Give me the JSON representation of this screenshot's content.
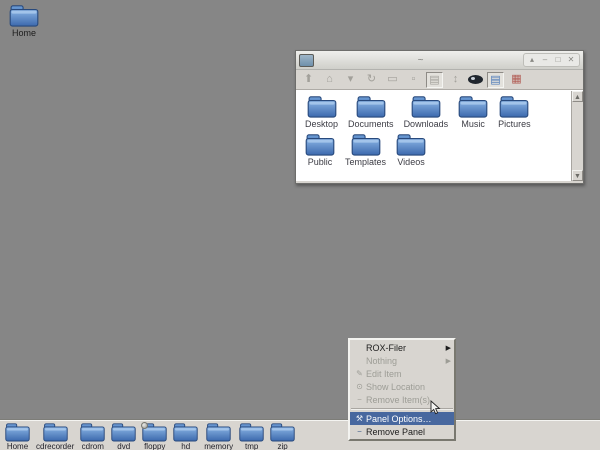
{
  "desktop": {
    "home_icon_label": "Home"
  },
  "window": {
    "title": "~",
    "titlebar_buttons": [
      {
        "name": "shade-button",
        "glyph": "▴"
      },
      {
        "name": "minimize-button",
        "glyph": "–"
      },
      {
        "name": "maximize-button",
        "glyph": "□"
      },
      {
        "name": "close-button",
        "glyph": "✕"
      }
    ],
    "toolbar_buttons": [
      {
        "name": "up-icon",
        "glyph": "⬆",
        "style": ""
      },
      {
        "name": "home-icon",
        "glyph": "⌂",
        "style": ""
      },
      {
        "name": "bookmarks-icon",
        "glyph": "▾",
        "style": ""
      },
      {
        "name": "refresh-icon",
        "glyph": "↻",
        "style": ""
      },
      {
        "name": "smaller-icons-icon",
        "glyph": "▭",
        "style": ""
      },
      {
        "name": "larger-icons-icon",
        "glyph": "▫",
        "style": ""
      },
      {
        "name": "icons-view-icon",
        "glyph": "▤",
        "style": "pressed"
      },
      {
        "name": "sort-icon",
        "glyph": "↕",
        "style": ""
      },
      {
        "name": "show-hidden-icon",
        "glyph": "",
        "style": "eye"
      },
      {
        "name": "details-view-icon",
        "glyph": "▤",
        "style": "pressed blue"
      },
      {
        "name": "select-all-icon",
        "glyph": "▦",
        "style": "red"
      }
    ],
    "folders": [
      "Desktop",
      "Documents",
      "Downloads",
      "Music",
      "Pictures",
      "Public",
      "Templates",
      "Videos"
    ],
    "scrollbar": {
      "up_glyph": "▲",
      "down_glyph": "▼"
    }
  },
  "menu": {
    "items": [
      {
        "label": "ROX-Filer",
        "state": "enabled",
        "icon": "",
        "submenu": true
      },
      {
        "label": "Nothing",
        "state": "disabled",
        "icon": "",
        "submenu": true
      },
      {
        "label": "Edit Item",
        "state": "disabled",
        "icon": "✎",
        "submenu": false
      },
      {
        "label": "Show Location",
        "state": "disabled",
        "icon": "⊙",
        "submenu": false
      },
      {
        "label": "Remove Item(s)",
        "state": "disabled",
        "icon": "−",
        "submenu": false
      },
      {
        "label": "Panel Options…",
        "state": "highlight",
        "icon": "⚒",
        "submenu": false
      },
      {
        "label": "Remove Panel",
        "state": "enabled",
        "icon": "−",
        "submenu": false
      }
    ],
    "separator_after_index": 4,
    "submenu_arrow": "▶"
  },
  "panel": {
    "items": [
      {
        "label": "Home",
        "emblem": false
      },
      {
        "label": "cdrecorder",
        "emblem": false
      },
      {
        "label": "cdrom",
        "emblem": false
      },
      {
        "label": "dvd",
        "emblem": false
      },
      {
        "label": "floppy",
        "emblem": true
      },
      {
        "label": "hd",
        "emblem": false
      },
      {
        "label": "memory",
        "emblem": false
      },
      {
        "label": "tmp",
        "emblem": false
      },
      {
        "label": "zip",
        "emblem": false
      }
    ]
  },
  "colors": {
    "desktop_bg": "#868686",
    "panel_bg": "#d8d5d0",
    "selection_blue": "#48689f",
    "folder_blue_light": "#8ab4e4",
    "folder_blue_dark": "#3c69ad",
    "folder_outline": "#28497c"
  }
}
